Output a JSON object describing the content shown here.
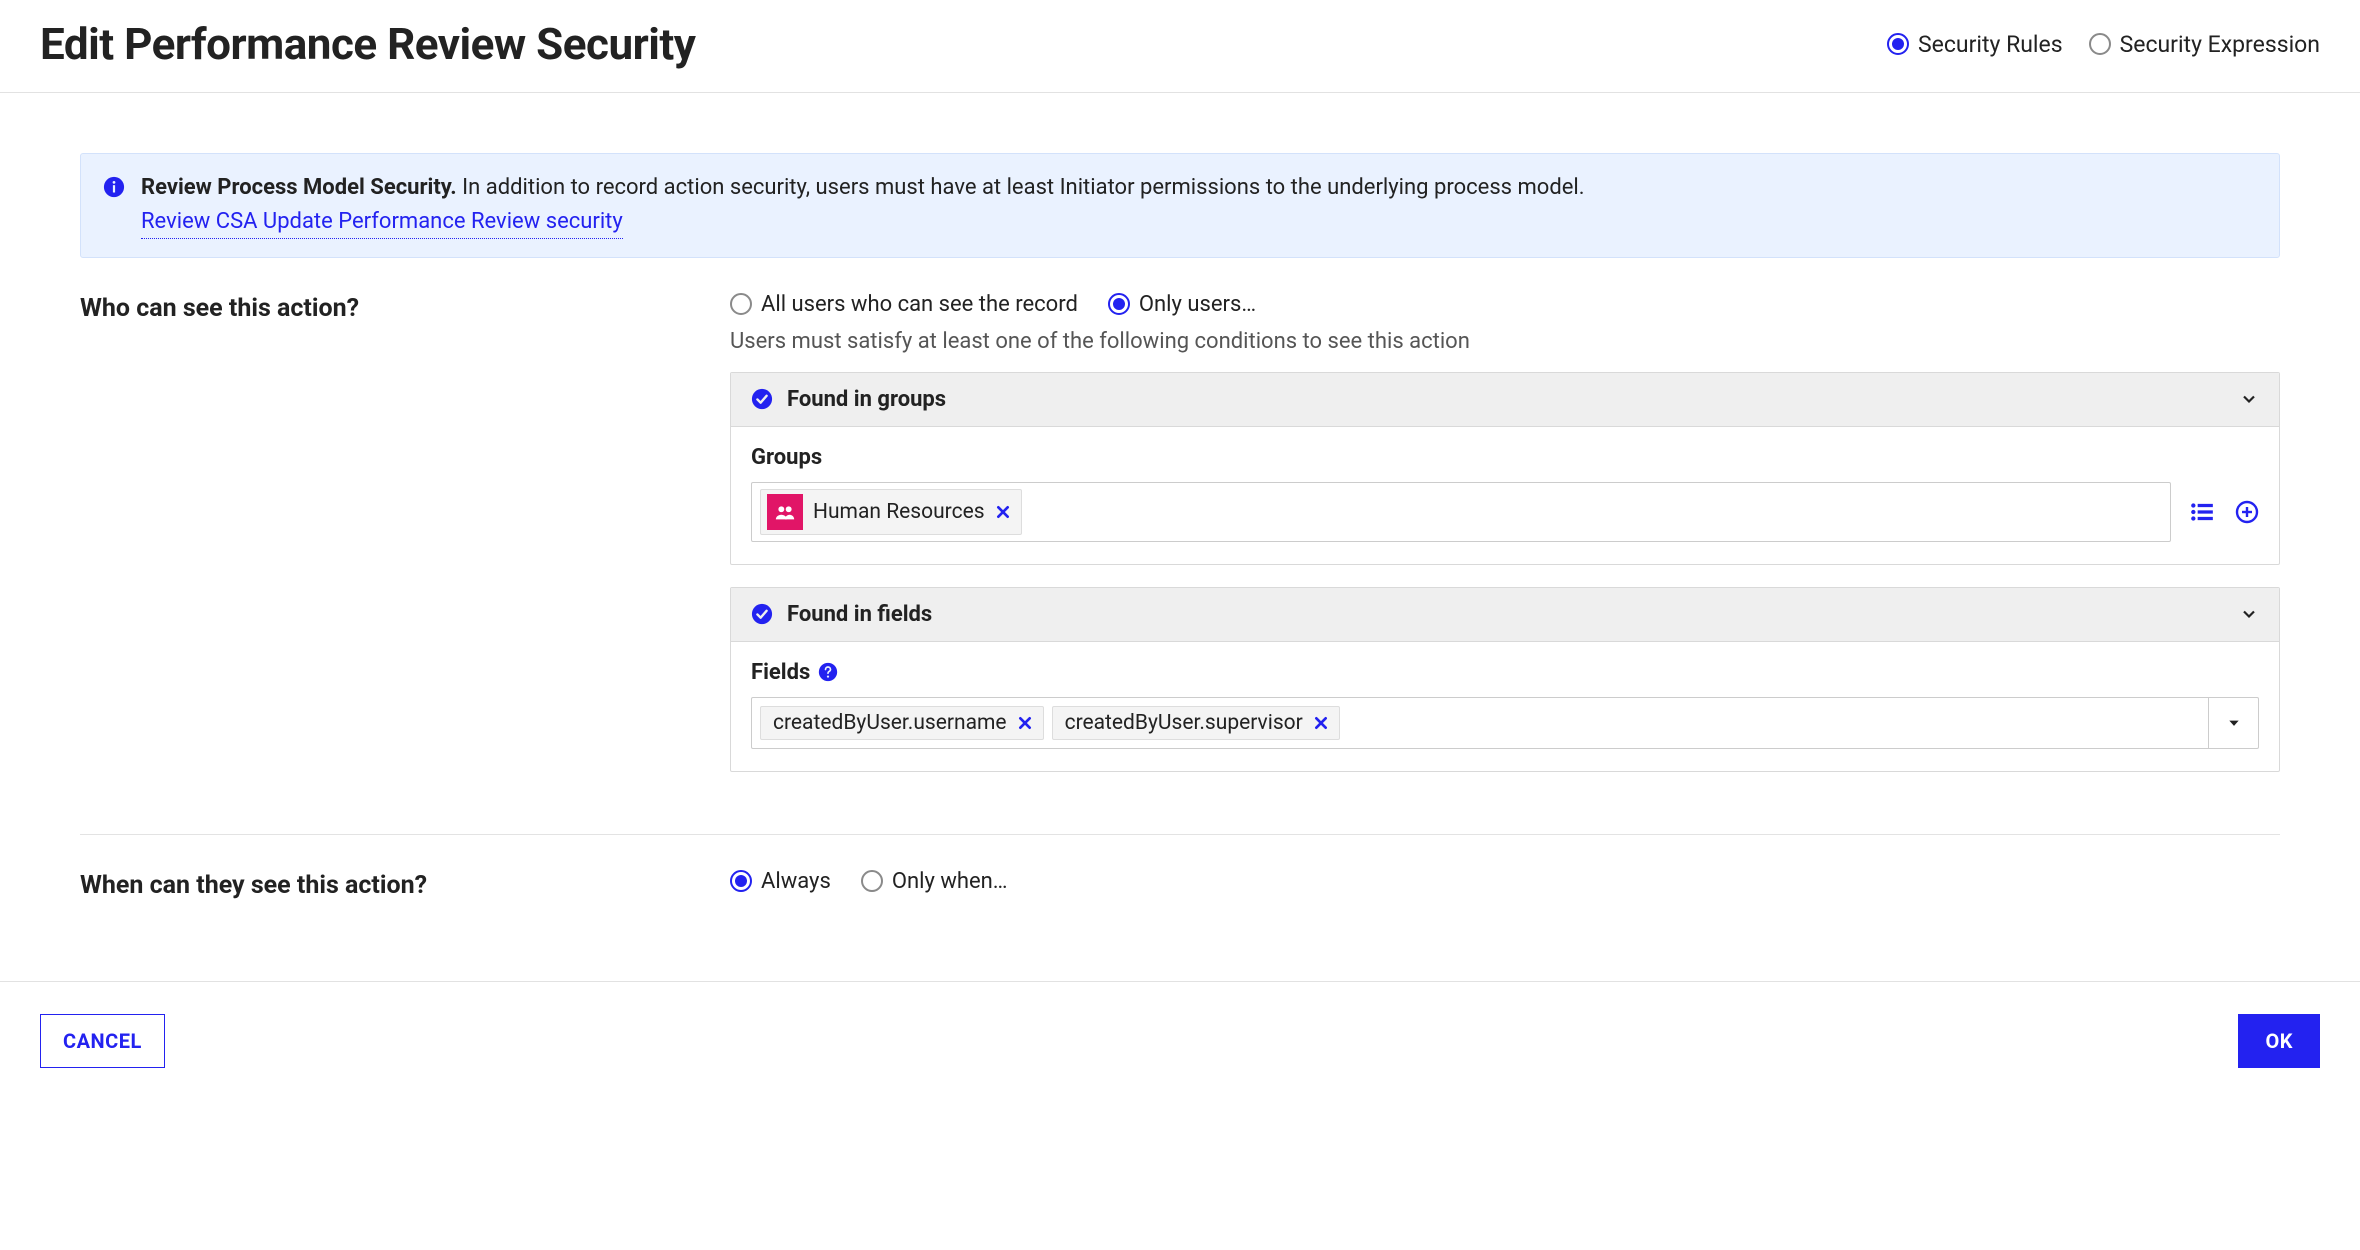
{
  "header": {
    "title": "Edit Performance Review Security",
    "tabs": {
      "rules_label": "Security Rules",
      "expression_label": "Security Expression",
      "selected": "rules"
    }
  },
  "banner": {
    "bold": "Review Process Model Security.",
    "text": "In addition to record action security, users must have at least Initiator permissions to the underlying process model.",
    "link": "Review CSA Update Performance Review security"
  },
  "who": {
    "label": "Who can see this action?",
    "option_all": "All users who can see the record",
    "option_only": "Only users…",
    "selected": "only",
    "hint": "Users must satisfy at least one of the following conditions to see this action",
    "groups_card": {
      "title": "Found in groups",
      "sublabel": "Groups",
      "chip1": "Human Resources"
    },
    "fields_card": {
      "title": "Found in fields",
      "sublabel": "Fields",
      "chip1": "createdByUser.username",
      "chip2": "createdByUser.supervisor"
    }
  },
  "when": {
    "label": "When can they see this action?",
    "option_always": "Always",
    "option_onlywhen": "Only when…",
    "selected": "always"
  },
  "footer": {
    "cancel": "CANCEL",
    "ok": "OK"
  }
}
